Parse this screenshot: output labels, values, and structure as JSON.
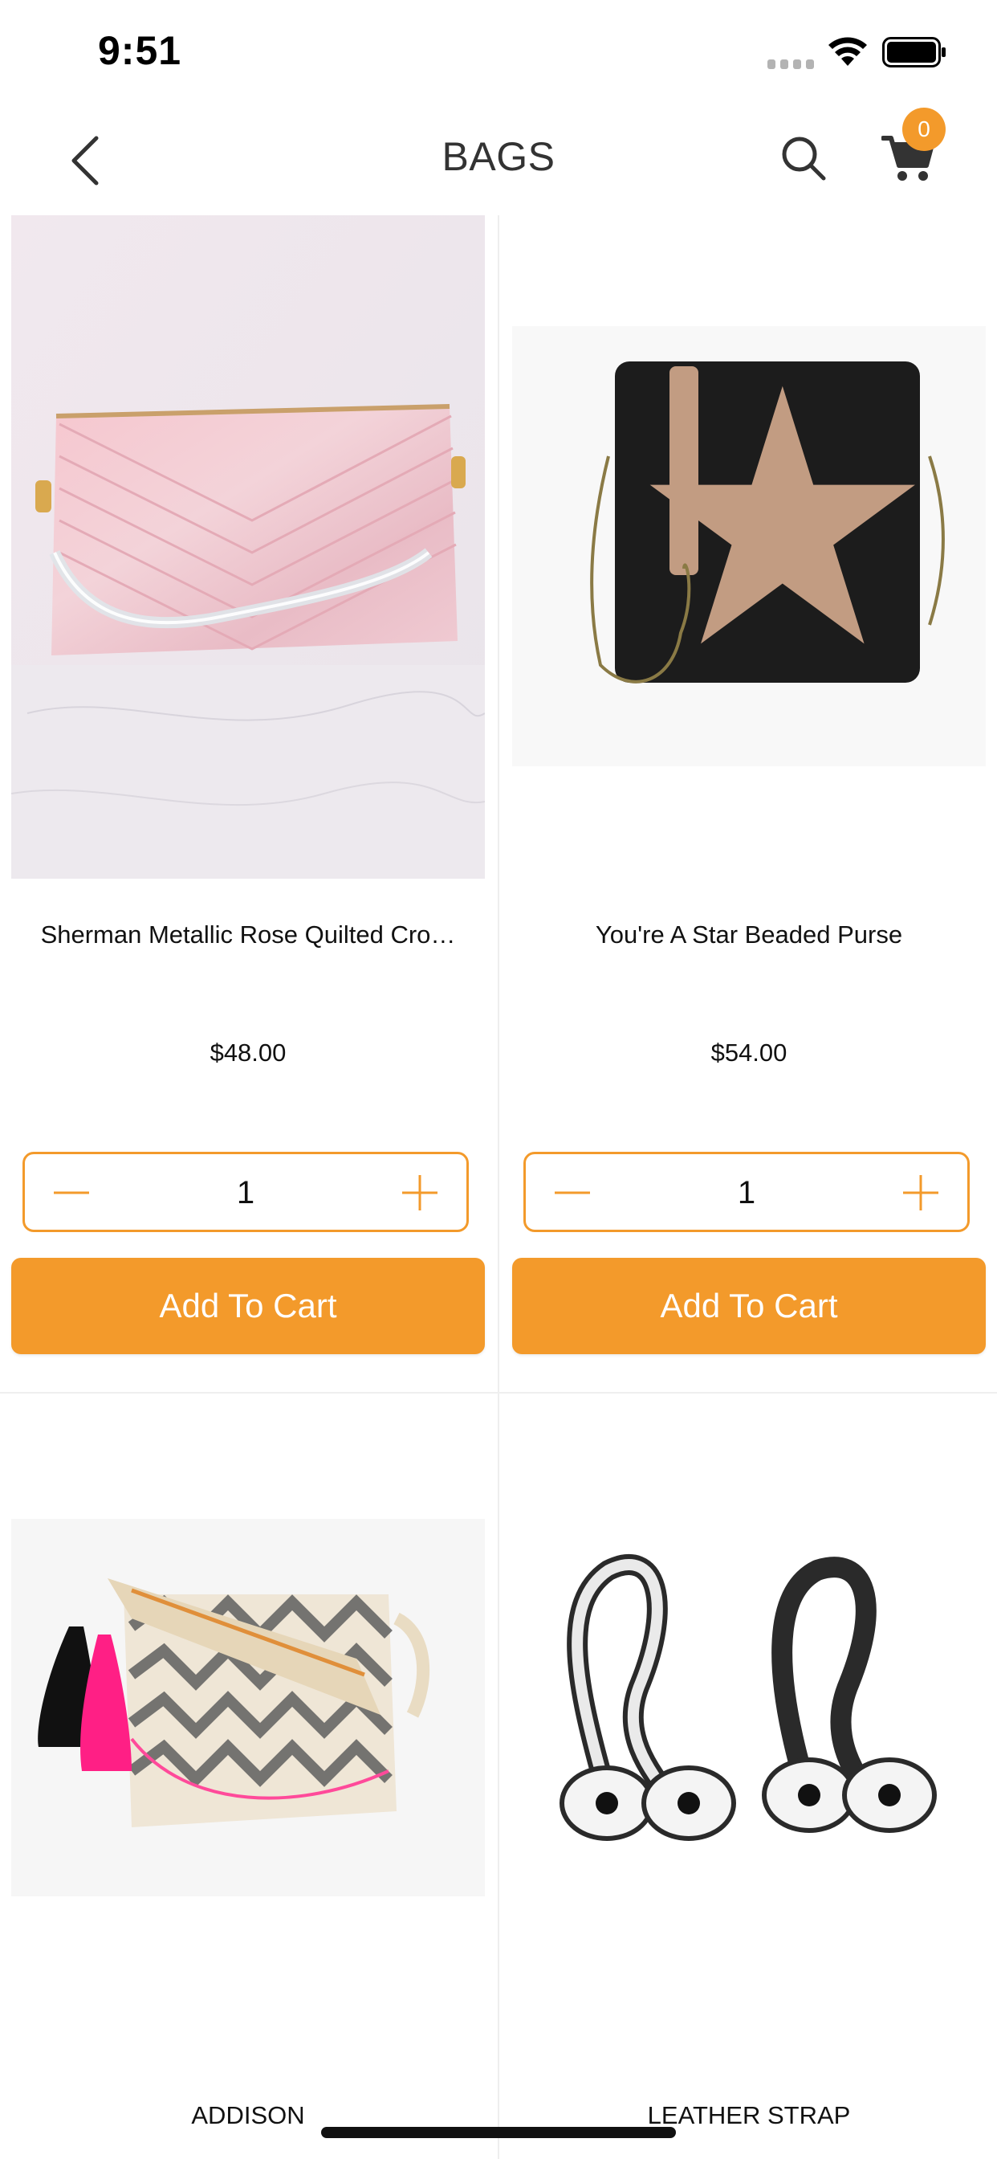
{
  "status_bar": {
    "time": "9:51"
  },
  "nav": {
    "title": "BAGS",
    "cart_count": "0"
  },
  "colors": {
    "accent": "#f39a2b"
  },
  "products": [
    {
      "name": "Sherman Metallic Rose Quilted Cro…",
      "price": "$48.00",
      "quantity": "1",
      "button": "Add To Cart"
    },
    {
      "name": "You're A Star Beaded Purse",
      "price": "$54.00",
      "quantity": "1",
      "button": "Add To Cart"
    },
    {
      "name": "ADDISON"
    },
    {
      "name": "LEATHER STRAP"
    }
  ]
}
